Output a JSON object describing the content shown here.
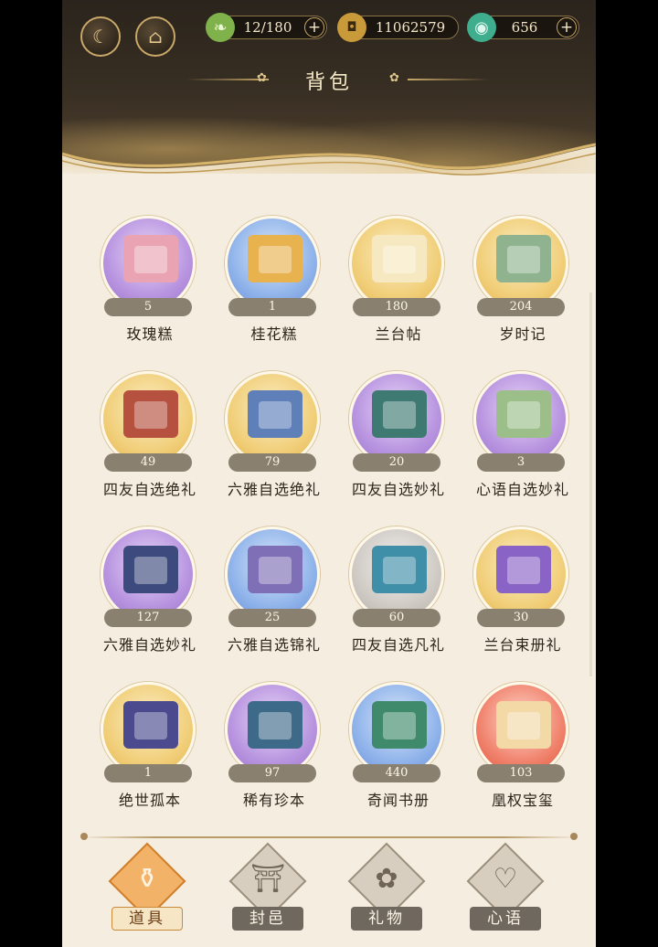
{
  "header": {
    "title": "背包",
    "left_icons": [
      "moon-cloud-icon",
      "pavilion-book-icon"
    ],
    "resources": [
      {
        "name": "leaf",
        "icon": "leaf-icon",
        "value": "12/180",
        "plus": "+"
      },
      {
        "name": "coin",
        "icon": "copper-coin-icon",
        "value": "11062579"
      },
      {
        "name": "jade",
        "icon": "jade-pendant-icon",
        "value": "656",
        "plus": "+"
      }
    ]
  },
  "items": [
    {
      "name": "玫瑰糕",
      "count": "5",
      "bg": "purple",
      "art": "#e9a3b2"
    },
    {
      "name": "桂花糕",
      "count": "1",
      "bg": "blue",
      "art": "#e8b24f"
    },
    {
      "name": "兰台帖",
      "count": "180",
      "bg": "gold",
      "art": "#f6e8c1"
    },
    {
      "name": "岁时记",
      "count": "204",
      "bg": "gold",
      "art": "#8fb38f"
    },
    {
      "name": "四友自选绝礼",
      "count": "49",
      "bg": "gold",
      "art": "#b6503f"
    },
    {
      "name": "六雅自选绝礼",
      "count": "79",
      "bg": "gold",
      "art": "#5f7fb8"
    },
    {
      "name": "四友自选妙礼",
      "count": "20",
      "bg": "purple",
      "art": "#3f7a72"
    },
    {
      "name": "心语自选妙礼",
      "count": "3",
      "bg": "purple",
      "art": "#9cbf8a"
    },
    {
      "name": "六雅自选妙礼",
      "count": "127",
      "bg": "purple",
      "art": "#3d4a7d"
    },
    {
      "name": "六雅自选锦礼",
      "count": "25",
      "bg": "blue",
      "art": "#7e6fb6"
    },
    {
      "name": "四友自选凡礼",
      "count": "60",
      "bg": "grey",
      "art": "#3f8fa8"
    },
    {
      "name": "兰台束册礼",
      "count": "30",
      "bg": "gold",
      "art": "#8a63c7"
    },
    {
      "name": "绝世孤本",
      "count": "1",
      "bg": "gold",
      "art": "#4b4a8e"
    },
    {
      "name": "稀有珍本",
      "count": "97",
      "bg": "purple",
      "art": "#3e6a8a"
    },
    {
      "name": "奇闻书册",
      "count": "440",
      "bg": "blue",
      "art": "#3e8a6a"
    },
    {
      "name": "凰权宝玺",
      "count": "103",
      "bg": "red",
      "art": "#f3d9a6"
    }
  ],
  "tabs": [
    {
      "label": "道具",
      "icon": "jar-icon",
      "glyph": "⚱",
      "active": true
    },
    {
      "label": "封邑",
      "icon": "pagoda-icon",
      "glyph": "⛩",
      "active": false
    },
    {
      "label": "礼物",
      "icon": "fan-icon",
      "glyph": "✿",
      "active": false
    },
    {
      "label": "心语",
      "icon": "heart-knot-icon",
      "glyph": "♡",
      "active": false
    }
  ]
}
